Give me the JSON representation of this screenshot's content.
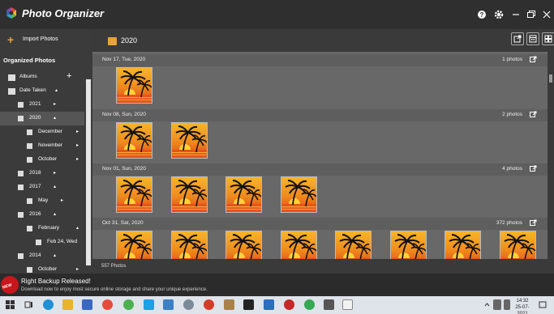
{
  "app": {
    "title": "Photo Organizer"
  },
  "sidebar": {
    "import_label": "Import Photos",
    "section_title": "Organized Photos",
    "tree": [
      {
        "label": "Albums",
        "level": 0,
        "icon": "album-icon",
        "action": "+"
      },
      {
        "label": "Date Taken",
        "level": 0,
        "icon": "calendar-icon",
        "arrow": "▴"
      },
      {
        "label": "2021",
        "level": 1,
        "icon": "calendar-icon",
        "arrow": "▸"
      },
      {
        "label": "2020",
        "level": 1,
        "icon": "calendar-icon",
        "arrow": "▴",
        "selected": true
      },
      {
        "label": "December",
        "level": 2,
        "icon": "calendar-icon",
        "arrow": "▸"
      },
      {
        "label": "November",
        "level": 2,
        "icon": "calendar-icon",
        "arrow": "▸"
      },
      {
        "label": "October",
        "level": 2,
        "icon": "calendar-icon",
        "arrow": "▸"
      },
      {
        "label": "2018",
        "level": 1,
        "icon": "calendar-icon",
        "arrow": "▸"
      },
      {
        "label": "2017",
        "level": 1,
        "icon": "calendar-icon",
        "arrow": "▴"
      },
      {
        "label": "May",
        "level": 2,
        "icon": "calendar-icon",
        "arrow": "▸"
      },
      {
        "label": "2016",
        "level": 1,
        "icon": "calendar-icon",
        "arrow": "▴"
      },
      {
        "label": "February",
        "level": 2,
        "icon": "calendar-icon",
        "arrow": "▴"
      },
      {
        "label": "Feb 24, Wed",
        "level": 3,
        "icon": "calendar-icon",
        "arrow": ""
      },
      {
        "label": "2014",
        "level": 1,
        "icon": "calendar-icon",
        "arrow": "▴"
      },
      {
        "label": "October",
        "level": 2,
        "icon": "calendar-icon",
        "arrow": "▸"
      }
    ]
  },
  "main": {
    "year_title": "2020",
    "groups": [
      {
        "date": "Nov 17, Tue, 2020",
        "count": "1 photos",
        "photos": 1
      },
      {
        "date": "Nov 08, Sun, 2020",
        "count": "2 photos",
        "photos": 2
      },
      {
        "date": "Nov 01, Sun, 2020",
        "count": "4 photos",
        "photos": 4
      },
      {
        "date": "Oct 31, Sat, 2020",
        "count": "372 photos",
        "photos": 8
      }
    ],
    "status_count": "557 Photos"
  },
  "notification": {
    "badge": "NEW",
    "title": "Right Backup Released!",
    "subtitle": "Download now to enjoy most secure online storage and share your unique experience."
  },
  "taskbar": {
    "time": "14:32",
    "date": "25-07-2021"
  },
  "colors": {
    "accent": "#e8a23a",
    "content_bg": "#686868",
    "badge_red": "#c8161d"
  }
}
